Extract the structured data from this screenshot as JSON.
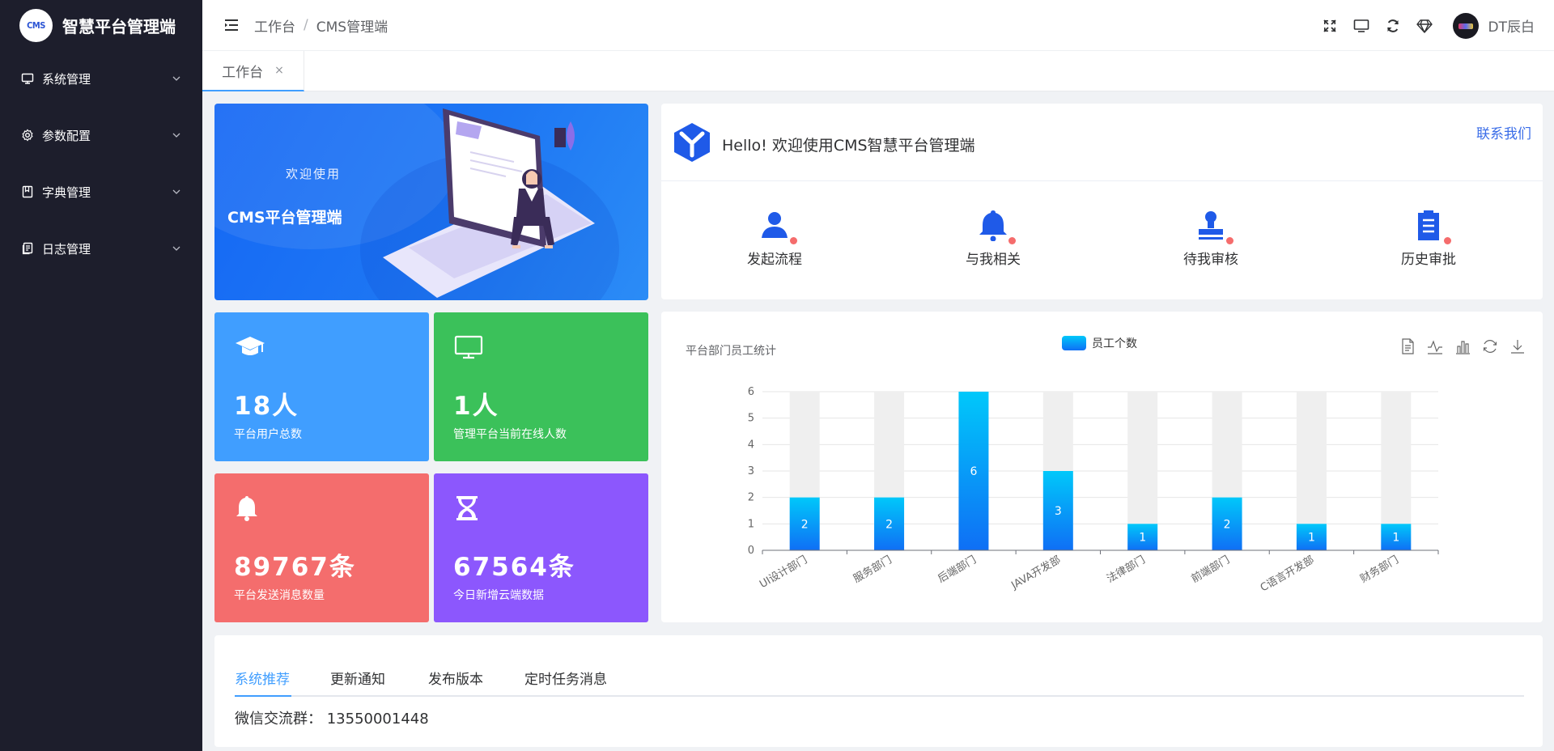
{
  "app": {
    "logo_text": "CMS",
    "title": "智慧平台管理端"
  },
  "sidebar": {
    "items": [
      {
        "label": "系统管理",
        "icon": "monitor-icon"
      },
      {
        "label": "参数配置",
        "icon": "gear-icon"
      },
      {
        "label": "字典管理",
        "icon": "book-icon"
      },
      {
        "label": "日志管理",
        "icon": "document-icon"
      }
    ]
  },
  "header": {
    "breadcrumb": [
      "工作台",
      "CMS管理端"
    ],
    "separator": "/",
    "username": "DT辰白"
  },
  "tabs": [
    {
      "label": "工作台",
      "close": "×"
    }
  ],
  "banner": {
    "welcome": "欢迎使用",
    "title": "CMS平台管理端"
  },
  "stats": [
    {
      "value": "18人",
      "label": "平台用户总数",
      "color": "#409eff",
      "icon": "graduation-cap-icon"
    },
    {
      "value": "1人",
      "label": "管理平台当前在线人数",
      "color": "#3bc15a",
      "icon": "monitor-icon"
    },
    {
      "value": "89767条",
      "label": "平台发送消息数量",
      "color": "#f56c6c",
      "icon": "bell-icon"
    },
    {
      "value": "67564条",
      "label": "今日新增云端数据",
      "color": "#8c57fd",
      "icon": "hourglass-icon"
    }
  ],
  "welcome_card": {
    "greeting": "Hello! 欢迎使用CMS智慧平台管理端",
    "contact": "联系我们",
    "quick_actions": [
      {
        "label": "发起流程",
        "icon": "user-icon"
      },
      {
        "label": "与我相关",
        "icon": "bell-icon"
      },
      {
        "label": "待我审核",
        "icon": "stamp-icon"
      },
      {
        "label": "历史审批",
        "icon": "clipboard-icon"
      }
    ]
  },
  "chart_card": {
    "title": "平台部门员工统计",
    "legend": "员工个数",
    "toolbox": [
      "data-view-icon",
      "line-chart-icon",
      "bar-chart-icon",
      "refresh-icon",
      "download-icon"
    ]
  },
  "chart_data": {
    "type": "bar",
    "title": "平台部门员工统计",
    "categories": [
      "UI设计部门",
      "服务部门",
      "后端部门",
      "JAVA开发部",
      "法律部门",
      "前端部门",
      "C语言开发部",
      "财务部门"
    ],
    "series": [
      {
        "name": "员工个数",
        "values": [
          2,
          2,
          6,
          3,
          1,
          2,
          1,
          1
        ]
      }
    ],
    "ylim": [
      0,
      6
    ],
    "yticks": [
      0,
      1,
      2,
      3,
      4,
      5,
      6
    ],
    "grid": true,
    "legend_position": "top-center",
    "background_bars": true,
    "colors": {
      "bar_top": "#00c8fa",
      "bar_bottom": "#0f6ff5",
      "background_bar": "#efefef"
    }
  },
  "bottom_card": {
    "tabs": [
      "系统推荐",
      "更新通知",
      "发布版本",
      "定时任务消息"
    ],
    "active_tab": 0,
    "content": "微信交流群： 13550001448"
  },
  "colors": {
    "accent": "#409eff",
    "sidebar_bg": "#1d1e2c",
    "brand_blue": "#1f5ae8"
  }
}
